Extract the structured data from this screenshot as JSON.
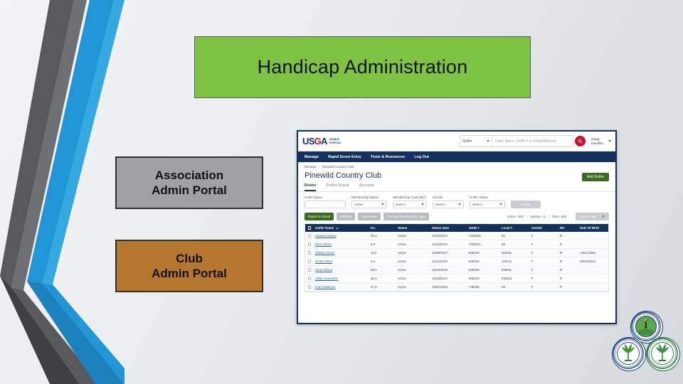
{
  "slide": {
    "title": "Handicap Administration",
    "callouts": [
      {
        "name": "association",
        "line1": "Association",
        "line2": "Admin Portal",
        "color": "#9ea2a6"
      },
      {
        "name": "club",
        "line1": "Club",
        "line2": "Admin Portal",
        "color": "#b5762d"
      }
    ]
  },
  "app": {
    "brand": {
      "usga_us": "US",
      "usga_g": "G",
      "usga_a": "A",
      "sub_line1": "ADMIN",
      "sub_line2": "PORTAL"
    },
    "search": {
      "scope": "Golfer",
      "placeholder": "Enter Name, GHIN # or Email Address",
      "icon": "search-icon"
    },
    "user": {
      "line1": "Doug",
      "line2": "Hanifolu"
    },
    "nav": [
      "Manage",
      "Rapid Score Entry",
      "Tools & Resources",
      "Log Out"
    ],
    "breadcrumb": {
      "root": "Manage",
      "sep": "›",
      "current": "Pinewild Country Club"
    },
    "page_title": "Pinewild Country Club",
    "add_button": "Add Golfer",
    "tabs": [
      {
        "label": "Roster",
        "active": true
      },
      {
        "label": "Golfer Group",
        "active": false
      },
      {
        "label": "Account",
        "active": false
      }
    ],
    "filters": [
      {
        "label": "Golfer Name",
        "value": "",
        "type": "text"
      },
      {
        "label": "Membership Status",
        "value": "Active",
        "type": "select"
      },
      {
        "label": "Membership Code (MC)",
        "value": "Select...",
        "type": "select"
      },
      {
        "label": "Gender",
        "value": "Select...",
        "type": "select"
      },
      {
        "label": "Golfer Status",
        "value": "Select...",
        "type": "select"
      }
    ],
    "reset_label": "Reset",
    "actions": [
      {
        "label": "Export to Excel",
        "style": "primary"
      },
      {
        "label": "Activate",
        "style": "muted"
      },
      {
        "label": "Deactivate",
        "style": "muted"
      },
      {
        "label": "Change Membership Type",
        "style": "muted"
      }
    ],
    "counts": [
      {
        "label": "Active - 642"
      },
      {
        "label": "Inactive - 0"
      },
      {
        "label": "Total - 642"
      }
    ],
    "page_size": "50 per Page",
    "table": {
      "columns": [
        "Golfer Name",
        "H.I.",
        "Status",
        "Status Date",
        "GHIN #",
        "Local #",
        "Gender",
        "MC",
        "Date Of Birth"
      ],
      "rows": [
        {
          "name": "Antoine Adams",
          "hi": "40.1",
          "status": "Active",
          "status_date": "11/15/2019",
          "ghin": "4431541",
          "local": "91",
          "gender": "F",
          "mc": "R",
          "dob": ""
        },
        {
          "name": "Paul Adams",
          "hi": "5.8",
          "status": "Active",
          "status_date": "11/15/2019",
          "ghin": "4430221",
          "local": "88",
          "gender": "F",
          "mc": "R",
          "dob": ""
        },
        {
          "name": "William Anson",
          "hi": "11.0",
          "status": "Active",
          "status_date": "10/09/2017",
          "ghin": "605140",
          "local": "20304L",
          "gender": "F",
          "mc": "R",
          "dob": "12/21/1950"
        },
        {
          "name": "Stuart Akers",
          "hi": "6.5",
          "status": "Active",
          "status_date": "11/21/2018",
          "ghin": "640103",
          "local": "10321L",
          "gender": "F",
          "mc": "R",
          "dob": "06/03/1942"
        },
        {
          "name": "Anna Allison",
          "hi": "55.0",
          "status": "Active",
          "status_date": "10/23/2019",
          "ghin": "605155",
          "local": "24004L",
          "gender": "F",
          "mc": "R",
          "dob": ""
        },
        {
          "name": "Libby Amundsen",
          "hi": "36.1",
          "status": "Active",
          "status_date": "11/15/2019",
          "ghin": "648128",
          "local": "048122",
          "gender": "F",
          "mc": "R",
          "dob": ""
        },
        {
          "name": "Lorri Anderson",
          "hi": "27.0",
          "status": "Active",
          "status_date": "10/07/2019",
          "ghin": "745150",
          "local": "26",
          "gender": "F",
          "mc": "R",
          "dob": ""
        }
      ]
    }
  },
  "seals": [
    {
      "name": "golf-association-seal-top",
      "ring": "#1b3f86"
    },
    {
      "name": "golf-association-seal-left",
      "ring": "#1b3f86"
    },
    {
      "name": "golf-association-seal-right",
      "ring": "#1e6b3a"
    }
  ]
}
